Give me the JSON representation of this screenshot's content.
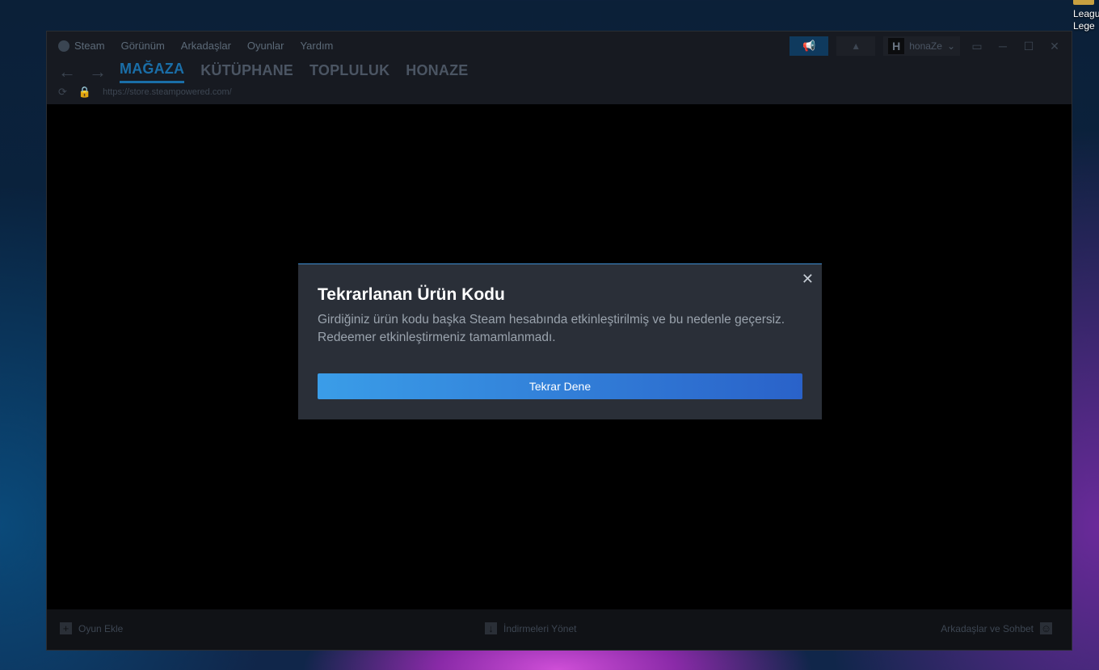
{
  "desktop": {
    "icon_line1": "Leagu",
    "icon_line2": "Lege"
  },
  "menu": [
    "Steam",
    "Görünüm",
    "Arkadaşlar",
    "Oyunlar",
    "Yardım"
  ],
  "tabs": [
    "MAĞAZA",
    "KÜTÜPHANE",
    "TOPLULUK",
    "HONAZE"
  ],
  "url": "https://store.steampowered.com/",
  "user": {
    "name": "honaZe",
    "avatar_letter": "H"
  },
  "dialog": {
    "title": "Tekrarlanan Ürün Kodu",
    "message": "Girdiğiniz ürün kodu başka Steam hesabında etkinleştirilmiş ve bu nedenle geçersiz. Redeemer etkinleştirmeniz tamamlanmadı.",
    "button": "Tekrar Dene",
    "close": "✕"
  },
  "footer": {
    "add_game": "Oyun Ekle",
    "downloads": "İndirmeleri Yönet",
    "friends": "Arkadaşlar ve Sohbet"
  },
  "icons": {
    "back": "arrow-left",
    "forward": "arrow-right",
    "reload": "reload",
    "lock": "lock",
    "announce": "megaphone",
    "bell": "bell"
  }
}
